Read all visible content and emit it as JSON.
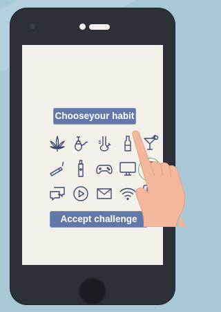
{
  "header": {
    "choose_label": "Chooseyour habit"
  },
  "footer": {
    "accept_label": "Accept challenge"
  },
  "icons": {
    "row1": [
      "cannabis-icon",
      "hookah-icon",
      "bong-icon",
      "bottle-icon",
      "cocktail-icon"
    ],
    "row2": [
      "cigarette-icon",
      "vape-icon",
      "gamepad-icon",
      "monitor-icon",
      "smartphone-icon"
    ],
    "row3": [
      "chat-icon",
      "play-icon",
      "mail-icon",
      "wifi-icon",
      "cards-icon"
    ]
  },
  "colors": {
    "accent": "#6478a8",
    "screen": "#f3f1ea",
    "phone": "#2d3038",
    "highlight": "#62b86b",
    "background": "#a9c8d6"
  }
}
